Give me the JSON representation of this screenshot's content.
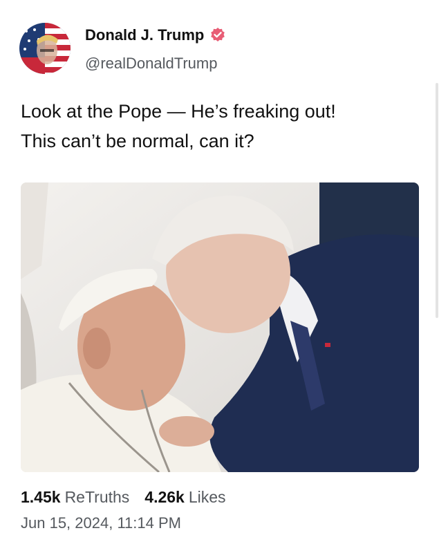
{
  "author": {
    "display_name": "Donald J. Trump",
    "handle": "@realDonaldTrump",
    "verified": true,
    "verified_color": "#e85d75",
    "avatar_icon": "flag-portrait-avatar"
  },
  "post": {
    "text_lines": [
      "Look at the Pope — He’s freaking out!",
      "This can’t be normal, can it?"
    ],
    "media_description_icon": "photo"
  },
  "stats": {
    "retruths_count": "1.45k",
    "retruths_label": "ReTruths",
    "likes_count": "4.26k",
    "likes_label": "Likes"
  },
  "timestamp": "Jun 15, 2024, 11:14 PM"
}
